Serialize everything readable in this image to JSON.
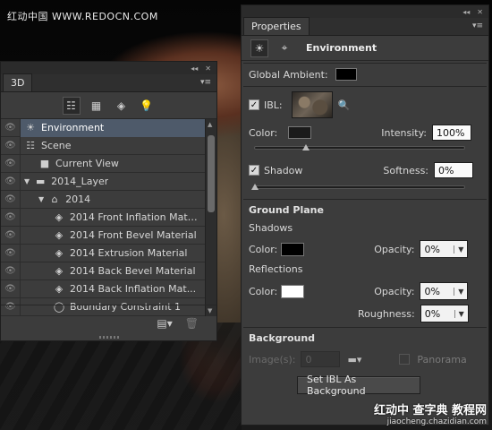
{
  "watermarks": {
    "top": "红动中国 WWW.REDOCN.COM",
    "bottom_main": "红动中 查字典 教程网",
    "bottom_sub": "jiaocheng.chazidian.com"
  },
  "panel_3d": {
    "tab_label": "3D",
    "toolbar": [
      "scene-filter-icon",
      "mesh-filter-icon",
      "material-filter-icon",
      "light-filter-icon"
    ],
    "rows": [
      {
        "label": "Environment",
        "icon": "☀",
        "indent": 0,
        "selected": true
      },
      {
        "label": "Scene",
        "icon": "☷",
        "indent": 0,
        "selected": false
      },
      {
        "label": "Current View",
        "icon": "■",
        "indent": 1,
        "selected": false
      },
      {
        "label": "2014_Layer",
        "icon": "▬",
        "indent": 0,
        "selected": false,
        "expander": "▼"
      },
      {
        "label": "2014",
        "icon": "⌂",
        "indent": 1,
        "selected": false,
        "expander": "▼"
      },
      {
        "label": "2014 Front Inflation Mate...",
        "icon": "◈",
        "indent": 2,
        "selected": false
      },
      {
        "label": "2014 Front Bevel Material",
        "icon": "◈",
        "indent": 2,
        "selected": false
      },
      {
        "label": "2014 Extrusion Material",
        "icon": "◈",
        "indent": 2,
        "selected": false
      },
      {
        "label": "2014 Back Bevel Material",
        "icon": "◈",
        "indent": 2,
        "selected": false
      },
      {
        "label": "2014 Back Inflation Mat...",
        "icon": "◈",
        "indent": 2,
        "selected": false
      },
      {
        "label": "Boundary Constraint 1",
        "icon": "◯",
        "indent": 2,
        "selected": false
      }
    ]
  },
  "properties": {
    "tab_label": "Properties",
    "header_title": "Environment",
    "global_ambient_label": "Global Ambient:",
    "ibl_label": "IBL:",
    "ibl_checked": true,
    "color_label": "Color:",
    "intensity_label": "Intensity:",
    "intensity_value": "100%",
    "intensity_level": 0.24,
    "shadow_label": "Shadow",
    "shadow_checked": true,
    "softness_label": "Softness:",
    "softness_value": "0%",
    "softness_level": 0.0,
    "ground_plane_title": "Ground Plane",
    "shadows_label": "Shadows",
    "shadows_color_label": "Color:",
    "shadows_opacity_label": "Opacity:",
    "shadows_opacity_value": "0%",
    "reflections_label": "Reflections",
    "reflections_color_label": "Color:",
    "reflections_opacity_label": "Opacity:",
    "reflections_opacity_value": "0%",
    "roughness_label": "Roughness:",
    "roughness_value": "0%",
    "background_title": "Background",
    "images_label": "Image(s):",
    "images_value": "0",
    "panorama_label": "Panorama",
    "set_ibl_button": "Set IBL As Background"
  },
  "colors": {
    "global_ambient": "#000000",
    "ibl_color": "#1a1a1a",
    "shadow_color": "#000000",
    "reflection_color": "#ffffff",
    "selection": "#4e5a6a"
  }
}
